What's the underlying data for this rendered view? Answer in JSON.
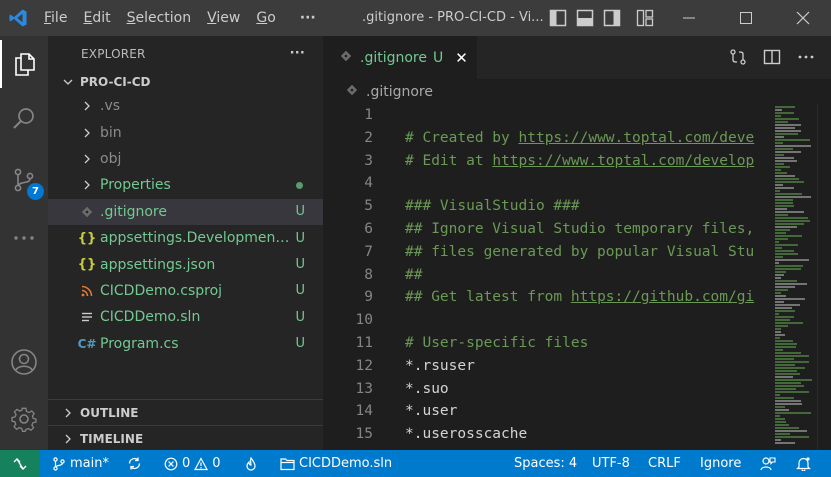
{
  "titlebar": {
    "menu": [
      {
        "label": "File",
        "mnemonic": "F",
        "rest": "ile"
      },
      {
        "label": "Edit",
        "mnemonic": "E",
        "rest": "dit"
      },
      {
        "label": "Selection",
        "mnemonic": "S",
        "rest": "election"
      },
      {
        "label": "View",
        "mnemonic": "V",
        "rest": "iew"
      },
      {
        "label": "Go",
        "mnemonic": "G",
        "rest": "o"
      }
    ],
    "more": "···",
    "window_title": ".gitignore - PRO-CI-CD - Vi..."
  },
  "activity": {
    "items": [
      "files-icon",
      "search-icon",
      "source-control-icon",
      "more-icon",
      "account-icon",
      "settings-gear-icon"
    ],
    "scm_badge": "7"
  },
  "sidebar": {
    "header": "EXPLORER",
    "more": "···",
    "folder": "PRO-CI-CD",
    "items": [
      {
        "label": ".vs",
        "kind": "folder",
        "status": ""
      },
      {
        "label": "bin",
        "kind": "folder",
        "status": ""
      },
      {
        "label": "obj",
        "kind": "folder",
        "status": ""
      },
      {
        "label": "Properties",
        "kind": "folder",
        "status": ""
      },
      {
        "label": ".gitignore",
        "kind": "file",
        "status": "U"
      },
      {
        "label": "appsettings.Development....",
        "kind": "file",
        "status": "U"
      },
      {
        "label": "appsettings.json",
        "kind": "file",
        "status": "U"
      },
      {
        "label": "CICDDemo.csproj",
        "kind": "file",
        "status": "U"
      },
      {
        "label": "CICDDemo.sln",
        "kind": "file",
        "status": "U"
      },
      {
        "label": "Program.cs",
        "kind": "file",
        "status": "U"
      }
    ],
    "outline": "OUTLINE",
    "timeline": "TIMELINE"
  },
  "editor": {
    "tab": {
      "label": ".gitignore",
      "status": "U",
      "close": "✕"
    },
    "breadcrumb": ".gitignore",
    "lines": [
      {
        "n": "1",
        "text": "",
        "link": "",
        "kind": "plain"
      },
      {
        "n": "2",
        "text": "# Created by ",
        "link": "https://www.toptal.com/deve",
        "kind": "comment"
      },
      {
        "n": "3",
        "text": "# Edit at ",
        "link": "https://www.toptal.com/develop",
        "kind": "comment"
      },
      {
        "n": "4",
        "text": "",
        "link": "",
        "kind": "plain"
      },
      {
        "n": "5",
        "text": "### VisualStudio ###",
        "link": "",
        "kind": "comment"
      },
      {
        "n": "6",
        "text": "## Ignore Visual Studio temporary files,",
        "link": "",
        "kind": "comment"
      },
      {
        "n": "7",
        "text": "## files generated by popular Visual Stu",
        "link": "",
        "kind": "comment"
      },
      {
        "n": "8",
        "text": "##",
        "link": "",
        "kind": "comment"
      },
      {
        "n": "9",
        "text": "## Get latest from ",
        "link": "https://github.com/gi",
        "kind": "comment"
      },
      {
        "n": "10",
        "text": "",
        "link": "",
        "kind": "plain"
      },
      {
        "n": "11",
        "text": "# User-specific files",
        "link": "",
        "kind": "comment"
      },
      {
        "n": "12",
        "text": "*.rsuser",
        "link": "",
        "kind": "plain"
      },
      {
        "n": "13",
        "text": "*.suo",
        "link": "",
        "kind": "plain"
      },
      {
        "n": "14",
        "text": "*.user",
        "link": "",
        "kind": "plain"
      },
      {
        "n": "15",
        "text": "*.userosscache",
        "link": "",
        "kind": "plain"
      }
    ]
  },
  "statusbar": {
    "branch": "main*",
    "errors": "0",
    "warnings": "0",
    "solution": "CICDDemo.sln",
    "spaces": "Spaces: 4",
    "encoding": "UTF-8",
    "eol": "CRLF",
    "language": "Ignore"
  },
  "colors": {
    "accent": "#007acc",
    "untracked": "#73c991",
    "comment": "#6a9955",
    "remote": "#16825d"
  }
}
